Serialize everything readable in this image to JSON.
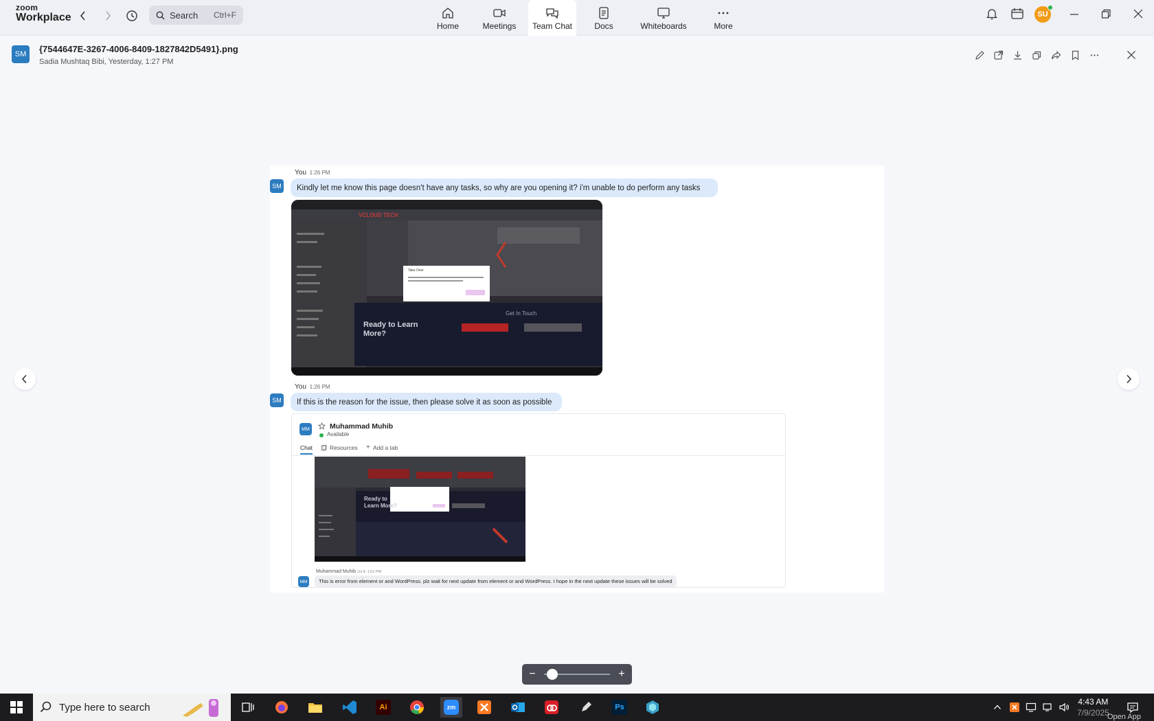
{
  "app": {
    "brand_small": "zoom",
    "brand_large": "Workplace",
    "search_label": "Search",
    "search_shortcut": "Ctrl+F",
    "tabs": [
      {
        "label": "Home",
        "icon": "home-icon"
      },
      {
        "label": "Meetings",
        "icon": "video-icon"
      },
      {
        "label": "Team Chat",
        "icon": "chat-icon",
        "active": true
      },
      {
        "label": "Docs",
        "icon": "doc-icon"
      },
      {
        "label": "Whiteboards",
        "icon": "whiteboard-icon"
      },
      {
        "label": "More",
        "icon": "more-icon"
      }
    ],
    "user_initials": "SU"
  },
  "viewer": {
    "avatar_initials": "SM",
    "file_name": "{7544647E-3267-4006-8409-1827842D5491}.png",
    "file_meta": "Sadia Mushtaq Bibi, Yesterday, 1:27 PM"
  },
  "image": {
    "messages": [
      {
        "sender": "You",
        "time": "1:26 PM",
        "avatar": "SM",
        "text": "Kindly let me know this page doesn't have any tasks, so why are you opening it? i'm unable to do perform any tasks"
      },
      {
        "sender": "You",
        "time": "1:26 PM",
        "avatar": "SM",
        "text": "If this is the reason for the issue, then please solve it as soon as possible"
      }
    ],
    "shot1": {
      "logo": "VCLOUD TECH",
      "heading": "Ready to Learn More?",
      "subheading": "Get In Touch",
      "dialog_title": "Take Over"
    },
    "quoted": {
      "avatar": "MM",
      "name": "Muhammad Muhib",
      "status": "Available",
      "tab_chat": "Chat",
      "tab_resources": "Resources",
      "tab_add": "Add a tab",
      "reply_sender": "Muhammad Muhib",
      "reply_time": "Jul 8, 1:52 PM",
      "reply_text": "This is error from element or and WordPress. plz wait for next update from element or and WordPress. I hope in the next update these issues will be solved",
      "mini_heading": "Ready to Learn More?"
    }
  },
  "zoom_control": {
    "minus": "−",
    "plus": "+",
    "level": 0.05
  },
  "taskbar": {
    "search_placeholder": "Type here to search",
    "clock_time": "4:43 AM",
    "clock_date": "7/9/2025",
    "open_app": "Open App"
  }
}
